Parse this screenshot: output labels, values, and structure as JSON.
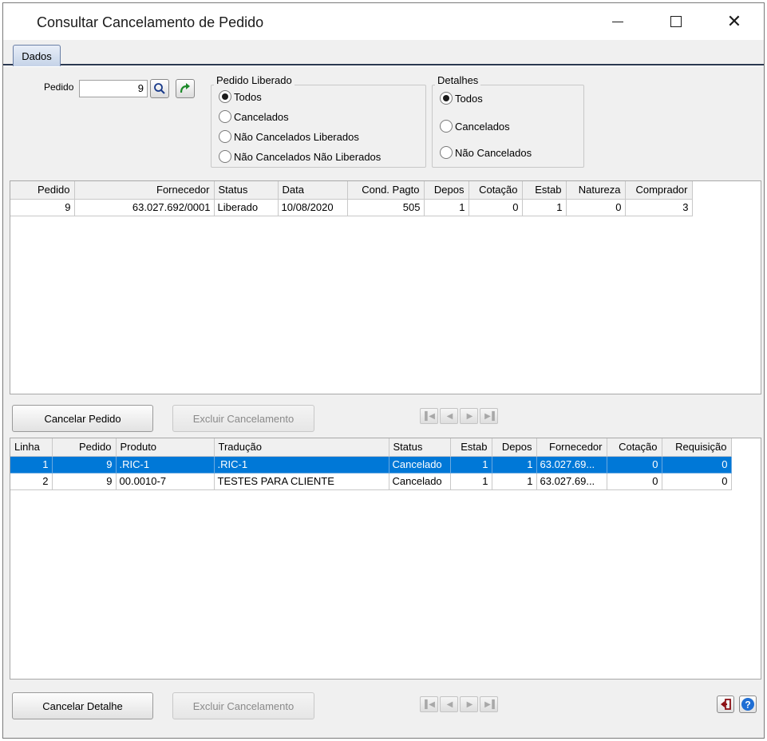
{
  "window": {
    "title": "Consultar Cancelamento de Pedido"
  },
  "tabs": [
    {
      "label": "Dados"
    }
  ],
  "filters": {
    "pedido_label": "Pedido",
    "pedido_value": "9",
    "pedido_liberado": {
      "title": "Pedido Liberado",
      "options": [
        "Todos",
        "Cancelados",
        "Não Cancelados Liberados",
        "Não Cancelados Não Liberados"
      ],
      "selected": "Todos"
    },
    "detalhes": {
      "title": "Detalhes",
      "options": [
        "Todos",
        "Cancelados",
        "Não Cancelados"
      ],
      "selected": "Todos"
    }
  },
  "orders_grid": {
    "columns": [
      "Pedido",
      "Fornecedor",
      "Status",
      "Data",
      "Cond. Pagto",
      "Depos",
      "Cotação",
      "Estab",
      "Natureza",
      "Comprador"
    ],
    "rows": [
      [
        "9",
        "63.027.692/0001",
        "Liberado",
        "10/08/2020",
        "505",
        "1",
        "0",
        "1",
        "0",
        "3"
      ]
    ]
  },
  "order_actions": {
    "cancel_label": "Cancelar Pedido",
    "delete_cancel_label": "Excluir Cancelamento"
  },
  "details_grid": {
    "columns": [
      "Linha",
      "Pedido",
      "Produto",
      "Tradução",
      "Status",
      "Estab",
      "Depos",
      "Fornecedor",
      "Cotação",
      "Requisição"
    ],
    "rows": [
      [
        "1",
        "9",
        ".RIC-1",
        ".RIC-1",
        "Cancelado",
        "1",
        "1",
        "63.027.69...",
        "0",
        "0"
      ],
      [
        "2",
        "9",
        "00.0010-7",
        "TESTES PARA CLIENTE",
        "Cancelado",
        "1",
        "1",
        "63.027.69...",
        "0",
        "0"
      ]
    ],
    "selected_row": 0
  },
  "detail_actions": {
    "cancel_label": "Cancelar Detalhe",
    "delete_cancel_label": "Excluir Cancelamento"
  },
  "icons": {
    "search": "search-icon",
    "refresh": "refresh-arrow-icon",
    "exit": "exit-icon",
    "help": "help-icon",
    "accent_color": "#0078d7"
  }
}
